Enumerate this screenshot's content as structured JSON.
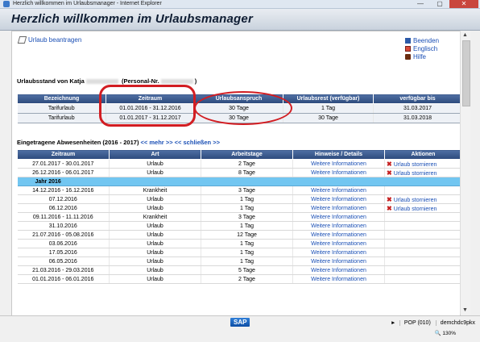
{
  "window": {
    "title": "Herzlich willkommen im Urlaubsmanager - Internet Explorer",
    "controls": [
      "—",
      "▢",
      "✕"
    ]
  },
  "page": {
    "heading": "Herzlich willkommen im Urlaubsmanager"
  },
  "links": {
    "request_leave": "Urlaub beantragen",
    "end": "Beenden",
    "english": "Englisch",
    "help": "Hilfe"
  },
  "status": {
    "title_prefix": "Urlaubsstand von Katja",
    "title_mid": "(Personal-Nr.",
    "title_suffix": ")",
    "columns": [
      "Bezeichnung",
      "Zeitraum",
      "Urlaubsanspruch",
      "Urlaubsrest (verfügbar)",
      "verfügbar bis"
    ],
    "rows": [
      [
        "Tarifurlaub",
        "01.01.2016 - 31.12.2016",
        "30 Tage",
        "1 Tag",
        "31.03.2017"
      ],
      [
        "Tarifurlaub",
        "01.01.2017 - 31.12.2017",
        "30 Tage",
        "30 Tage",
        "31.03.2018"
      ]
    ]
  },
  "absences": {
    "title": "Eingetragene Abwesenheiten (2016 - 2017)",
    "more": "<< mehr >>",
    "close": "<< schließen >>",
    "columns": [
      "Zeitraum",
      "Art",
      "Arbeitstage",
      "Hinweise / Details",
      "Aktionen"
    ],
    "rows": [
      {
        "period": "27.01.2017 - 30.01.2017",
        "type": "Urlaub",
        "days": "2 Tage",
        "details": "Weitere Informationen",
        "action": "Urlaub stornieren"
      },
      {
        "period": "26.12.2016 - 06.01.2017",
        "type": "Urlaub",
        "days": "8 Tage",
        "details": "Weitere Informationen",
        "action": "Urlaub stornieren"
      },
      {
        "year": "Jahr 2016"
      },
      {
        "period": "14.12.2016 - 16.12.2016",
        "type": "Krankheit",
        "days": "3 Tage",
        "details": "Weitere Informationen",
        "action": ""
      },
      {
        "period": "07.12.2016",
        "type": "Urlaub",
        "days": "1 Tag",
        "details": "Weitere Informationen",
        "action": "Urlaub stornieren"
      },
      {
        "period": "06.12.2016",
        "type": "Urlaub",
        "days": "1 Tag",
        "details": "Weitere Informationen",
        "action": "Urlaub stornieren"
      },
      {
        "period": "09.11.2016 - 11.11.2016",
        "type": "Krankheit",
        "days": "3 Tage",
        "details": "Weitere Informationen",
        "action": ""
      },
      {
        "period": "31.10.2016",
        "type": "Urlaub",
        "days": "1 Tag",
        "details": "Weitere Informationen",
        "action": ""
      },
      {
        "period": "21.07.2016 - 05.08.2016",
        "type": "Urlaub",
        "days": "12 Tage",
        "details": "Weitere Informationen",
        "action": ""
      },
      {
        "period": "03.06.2016",
        "type": "Urlaub",
        "days": "1 Tag",
        "details": "Weitere Informationen",
        "action": ""
      },
      {
        "period": "17.05.2016",
        "type": "Urlaub",
        "days": "1 Tag",
        "details": "Weitere Informationen",
        "action": ""
      },
      {
        "period": "06.05.2016",
        "type": "Urlaub",
        "days": "1 Tag",
        "details": "Weitere Informationen",
        "action": ""
      },
      {
        "period": "21.03.2016 - 29.03.2016",
        "type": "Urlaub",
        "days": "5 Tage",
        "details": "Weitere Informationen",
        "action": ""
      },
      {
        "period": "01.01.2016 - 06.01.2016",
        "type": "Urlaub",
        "days": "2 Tage",
        "details": "Weitere Informationen",
        "action": ""
      }
    ]
  },
  "statusbar": {
    "sap": "SAP",
    "pop": "POP (010)",
    "host": "demchdc9pkx",
    "zoom": "130%"
  },
  "colors": {
    "header_bg": "#2d4a7c",
    "year_row": "#72c6f1",
    "link": "#1a4fb5",
    "annotation": "#d21d22"
  }
}
